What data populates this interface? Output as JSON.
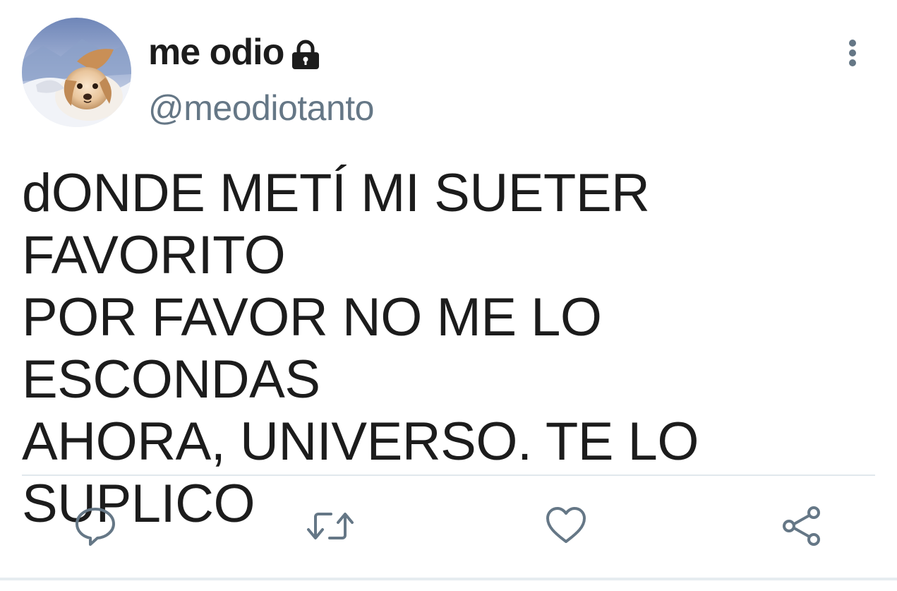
{
  "author": {
    "display_name": "me odio",
    "handle": "@meodiotanto",
    "protected": true,
    "avatar_icon": "puppy-avatar",
    "lock_icon": "lock-icon"
  },
  "tweet": {
    "text": "dONDE METÍ MI SUETER FAVORITO\nPOR FAVOR NO ME LO ESCONDAS\nAHORA, UNIVERSO. TE LO SUPLICO"
  },
  "actions": [
    {
      "name": "reply",
      "icon": "speech-bubble-icon"
    },
    {
      "name": "retweet",
      "icon": "retweet-arrows-icon"
    },
    {
      "name": "like",
      "icon": "heart-icon"
    },
    {
      "name": "share",
      "icon": "share-nodes-icon"
    }
  ],
  "colors": {
    "text": "#1c1c1c",
    "secondary": "#657786",
    "divider": "#e1e8ed",
    "background": "#ffffff"
  }
}
